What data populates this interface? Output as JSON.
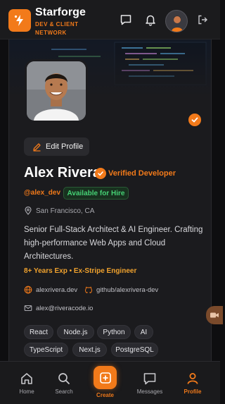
{
  "app": {
    "brand_name": "Starforge",
    "brand_tagline": "DEV & CLIENT NETWORK",
    "accent_color": "#f27a1a"
  },
  "header": {
    "icons": [
      "chat-icon",
      "bell-icon",
      "avatar",
      "logout-icon"
    ]
  },
  "profile": {
    "edit_label": "Edit Profile",
    "name": "Alex Rivera",
    "verified_label": "Verified Developer",
    "handle": "@alex_dev",
    "availability": "Available for Hire",
    "location": "San Francisco, CA",
    "bio": "Senior Full-Stack Architect & AI Engineer. Crafting high-performance Web Apps and Cloud Architectures.",
    "experience": "8+ Years Exp • Ex-Stripe Engineer",
    "website": "alexrivera.dev",
    "github": "github/alexrivera-dev",
    "email": "alex@riveracode.io",
    "tags": [
      "React",
      "Node.js",
      "Python",
      "AI",
      "TypeScript",
      "Next.js",
      "PostgreSQL"
    ]
  },
  "nav": {
    "home": "Home",
    "search": "Search",
    "create": "Create",
    "messages": "Messages",
    "profile": "Profile",
    "active": "profile"
  }
}
